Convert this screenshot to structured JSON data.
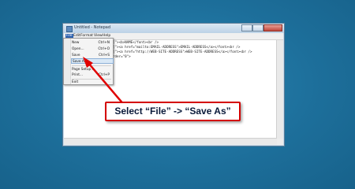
{
  "window": {
    "title": "Untitled - Notepad",
    "app_icon": "notepad-icon"
  },
  "menubar": {
    "file": "File",
    "edit": "Edit",
    "format": "Format",
    "view": "View",
    "help": "Help"
  },
  "editor": {
    "lines": [
      "[\"><b>NAME</font><br />",
      "[\"><a href=\"mailto:EMAIL-ADDRESS\">EMAIL-ADDRESS</a></font><br />",
      "[\"><a href=\"http://WEB-SITE-ADDRESS\">WEB-SITE-ADDRESS</a></font><br />",
      "rder=\"0\">"
    ]
  },
  "file_menu": {
    "items": [
      {
        "label": "New",
        "shortcut": "Ctrl+N"
      },
      {
        "label": "Open...",
        "shortcut": "Ctrl+O"
      },
      {
        "label": "Save",
        "shortcut": "Ctrl+S"
      },
      {
        "label": "Save As...",
        "shortcut": ""
      },
      {
        "label": "Page Setup...",
        "shortcut": ""
      },
      {
        "label": "Print...",
        "shortcut": "Ctrl+P"
      },
      {
        "label": "Exit",
        "shortcut": ""
      }
    ]
  },
  "callout": {
    "text": "Select “File” -> “Save As”"
  },
  "colors": {
    "background": "#1d6f9b",
    "callout_border": "#d40000",
    "arrow": "#e00000",
    "menu_highlight": "#2f63b0"
  }
}
